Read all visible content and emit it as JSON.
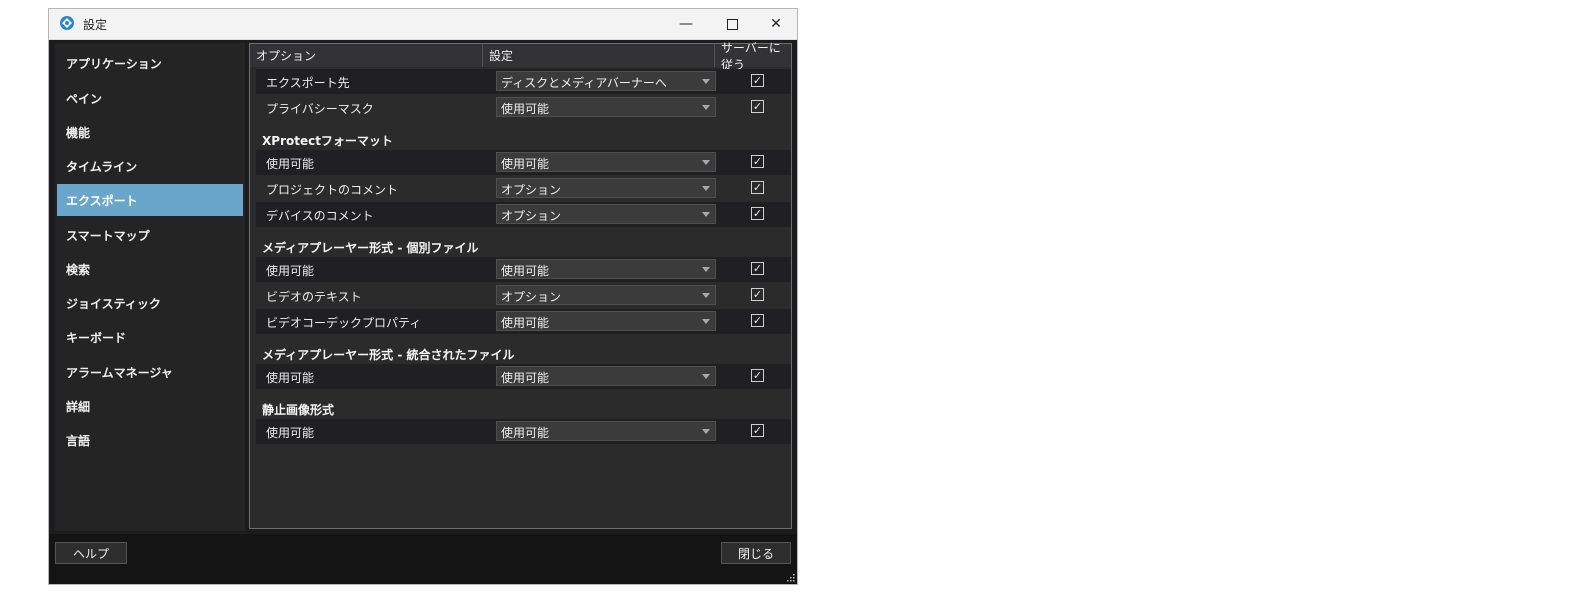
{
  "window": {
    "title": "設定"
  },
  "sidebar": {
    "items": [
      {
        "label": "アプリケーション"
      },
      {
        "label": "ペイン"
      },
      {
        "label": "機能"
      },
      {
        "label": "タイムライン"
      },
      {
        "label": "エクスポート",
        "active": true
      },
      {
        "label": "スマートマップ"
      },
      {
        "label": "検索"
      },
      {
        "label": "ジョイスティック"
      },
      {
        "label": "キーボード"
      },
      {
        "label": "アラームマネージャ"
      },
      {
        "label": "詳細"
      },
      {
        "label": "言語"
      }
    ]
  },
  "table": {
    "headers": {
      "option": "オプション",
      "setting": "設定",
      "follow_server": "サーバーに従う"
    },
    "rows": [
      {
        "type": "row",
        "label": "エクスポート先",
        "value": "ディスクとメディアバーナーへ",
        "checked": true
      },
      {
        "type": "row",
        "label": "プライバシーマスク",
        "value": "使用可能",
        "checked": true
      },
      {
        "type": "section",
        "label": "XProtectフォーマット"
      },
      {
        "type": "row",
        "label": "使用可能",
        "value": "使用可能",
        "checked": true
      },
      {
        "type": "row",
        "label": "プロジェクトのコメント",
        "value": "オプション",
        "checked": true
      },
      {
        "type": "row",
        "label": "デバイスのコメント",
        "value": "オプション",
        "checked": true
      },
      {
        "type": "section",
        "label": "メディアプレーヤー形式 - 個別ファイル"
      },
      {
        "type": "row",
        "label": "使用可能",
        "value": "使用可能",
        "checked": true
      },
      {
        "type": "row",
        "label": "ビデオのテキスト",
        "value": "オプション",
        "checked": true
      },
      {
        "type": "row",
        "label": "ビデオコーデックプロパティ",
        "value": "使用可能",
        "checked": true
      },
      {
        "type": "section",
        "label": "メディアプレーヤー形式 - 統合されたファイル"
      },
      {
        "type": "row",
        "label": "使用可能",
        "value": "使用可能",
        "checked": true
      },
      {
        "type": "section",
        "label": "静止画像形式"
      },
      {
        "type": "row",
        "label": "使用可能",
        "value": "使用可能",
        "checked": true
      }
    ]
  },
  "footer": {
    "help_label": "ヘルプ",
    "close_label": "閉じる"
  },
  "colors": {
    "accent": "#6aa6c9",
    "background": "#1c1c1e"
  }
}
